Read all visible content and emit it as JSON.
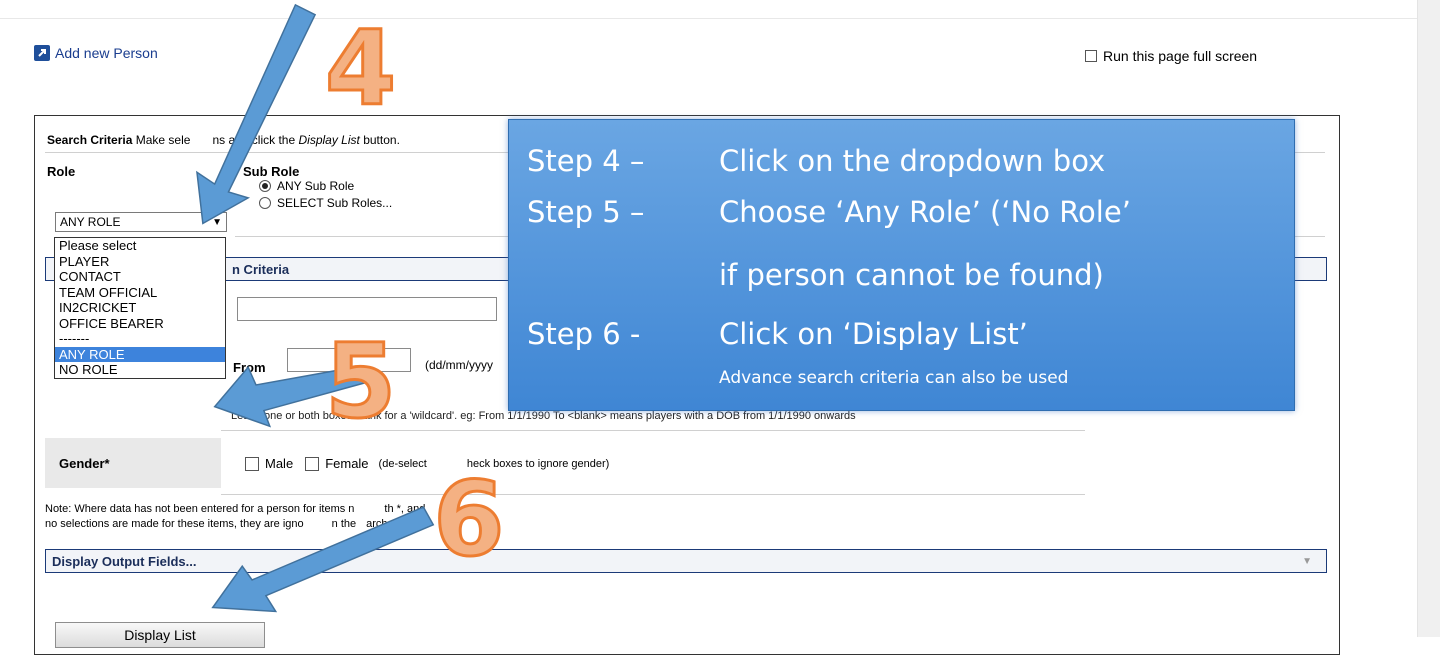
{
  "header": {
    "add_person": "Add new Person",
    "fullscreen": "Run this page full screen"
  },
  "search": {
    "criteria_title": "Search Criteria",
    "criteria_hint_a": "Make sele",
    "criteria_hint_b": "ns and click the",
    "criteria_hint_em": "Display List",
    "criteria_hint_c": "button.",
    "role_label": "Role",
    "subrole_label": "Sub Role",
    "any_subrole": "ANY Sub Role",
    "select_subroles": "SELECT Sub Roles...",
    "role_value": "ANY ROLE",
    "person_criteria": "n Criteria",
    "from_label": "From",
    "date_hint": "(dd/mm/yyyy",
    "wildcard_note": "Leave one or both boxes blank for a 'wildcard'. eg: From 1/1/1990 To <blank> means players with a DOB from 1/1/1990 onwards",
    "gender_label": "Gender*",
    "male": "Male",
    "female": "Female",
    "gender_note_a": "(de-select",
    "gender_note_b": "heck boxes to ignore gender)",
    "note_line1": "Note: Where data has not been entered for a person for items n",
    "note_line1b": "th *, and",
    "note_line2": "no selections are made for these items, they are igno",
    "note_line2b": "n the",
    "note_line2c": "arch",
    "output_fields": "Display Output Fields...",
    "display_list": "Display List"
  },
  "role_options": [
    "Please select",
    "PLAYER",
    "CONTACT",
    "TEAM OFFICIAL",
    "IN2CRICKET",
    "OFFICE BEARER",
    "-------",
    "ANY ROLE",
    "NO ROLE"
  ],
  "role_selected_index": 7,
  "callout": {
    "s4_num": "Step 4 –",
    "s4_txt": "Click on the dropdown box",
    "s5_num": "Step 5 –",
    "s5_txt": "Choose ‘Any Role’ (‘No Role’",
    "s5_txt2": "if person cannot be found)",
    "s6_num": "Step 6 -",
    "s6_txt": "Click on ‘Display List’",
    "s6_sub": "Advance search criteria can also be used"
  },
  "markers": {
    "m4": "4",
    "m5": "5",
    "m6": "6"
  },
  "colors": {
    "accent_blue": "#3f86d4",
    "marker_orange": "#f4b183",
    "marker_stroke": "#ed7d31",
    "arrow_blue": "#5b9bd5"
  }
}
